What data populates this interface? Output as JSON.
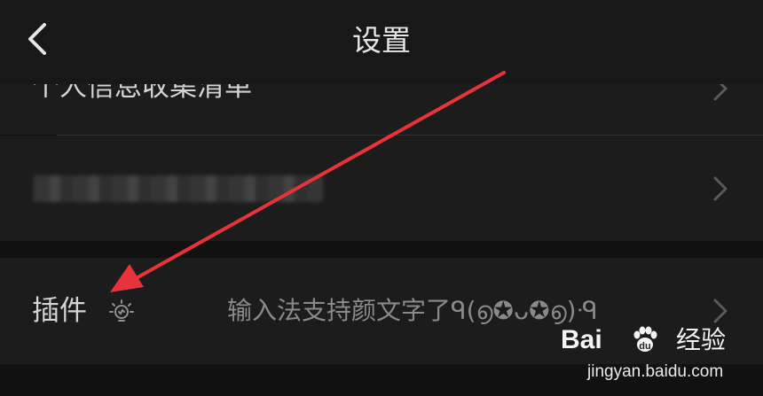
{
  "header": {
    "title": "设置",
    "back_icon": "chevron-left-icon"
  },
  "rows": [
    {
      "label": "个人信息收集清单"
    },
    {
      "label": ""
    },
    {
      "label": "插件",
      "icon": "lightbulb-icon",
      "description": "输入法支持颜文字了ᑫ(൭✪ᴗ✪൭)ᑴ"
    }
  ],
  "annotation": {
    "color": "#e8333a"
  },
  "watermark": {
    "logo": "Bai",
    "suffix": "经验",
    "url": "jingyan.baidu.com"
  }
}
